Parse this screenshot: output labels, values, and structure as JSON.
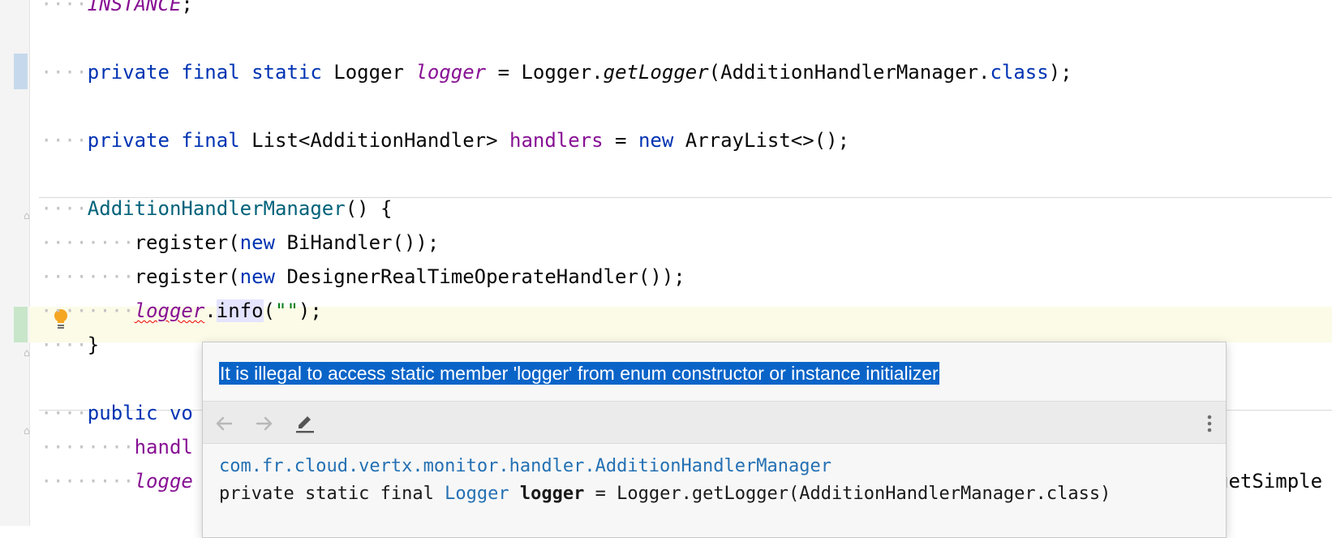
{
  "editor": {
    "lines": {
      "l1": {
        "ws": "····",
        "field": "INSTANCE",
        "semi": ";"
      },
      "l2": {
        "ws": "····",
        "kw1": "private",
        "kw2": "final",
        "kw3": "static",
        "type": "Logger",
        "field": "logger",
        "op": " = Logger.",
        "method": "getLogger",
        "arg": "(AdditionHandlerManager.",
        "kw4": "class",
        "end": ");"
      },
      "l3": {
        "ws": "····",
        "kw1": "private",
        "kw2": "final",
        "type": "List<AdditionHandler>",
        "field": "handlers",
        "op": " = ",
        "kw3": "new",
        "rest": " ArrayList<>();"
      },
      "l4": {
        "ws": "····",
        "ctor": "AdditionHandlerManager",
        "rest": "() {"
      },
      "l5": {
        "ws": "········",
        "call": "register(",
        "kw": "new",
        "rest": " BiHandler());"
      },
      "l6": {
        "ws": "········",
        "call": "register(",
        "kw": "new",
        "rest": " DesignerRealTimeOperateHandler());"
      },
      "l7": {
        "ws": "········",
        "field": "logger",
        "dot": ".",
        "method": "info",
        "open": "(",
        "str": "\"\"",
        "close": ");"
      },
      "l8": {
        "ws": "····",
        "rest": "}"
      },
      "l9": {
        "ws": "····",
        "kw": "public",
        "rest": " vo"
      },
      "l10": {
        "ws": "········",
        "rest": "handl"
      },
      "l11": {
        "ws": "········",
        "field": "logge",
        "tail": "getSimple"
      }
    }
  },
  "popup": {
    "message": "It is illegal to access static member 'logger' from enum constructor or instance initializer",
    "doc": {
      "package": "com.fr.cloud.vertx.monitor.handler.AdditionHandlerManager",
      "sig_prefix": "private static final ",
      "sig_type": "Logger",
      "sig_name": "logger",
      "sig_rest": " = Logger.getLogger(AdditionHandlerManager.class)"
    }
  },
  "colors": {
    "keyword": "#0033b3",
    "field": "#871094",
    "constructor": "#00627a",
    "string": "#067d17",
    "selection": "#0a64c8",
    "link": "#2470b3",
    "current_line": "#fcfbe8",
    "bulb": "#f5a623"
  },
  "icons": [
    "bulb-icon",
    "back-arrow-icon",
    "forward-arrow-icon",
    "edit-pencil-icon",
    "more-vert-icon",
    "fold-marker-icon"
  ]
}
